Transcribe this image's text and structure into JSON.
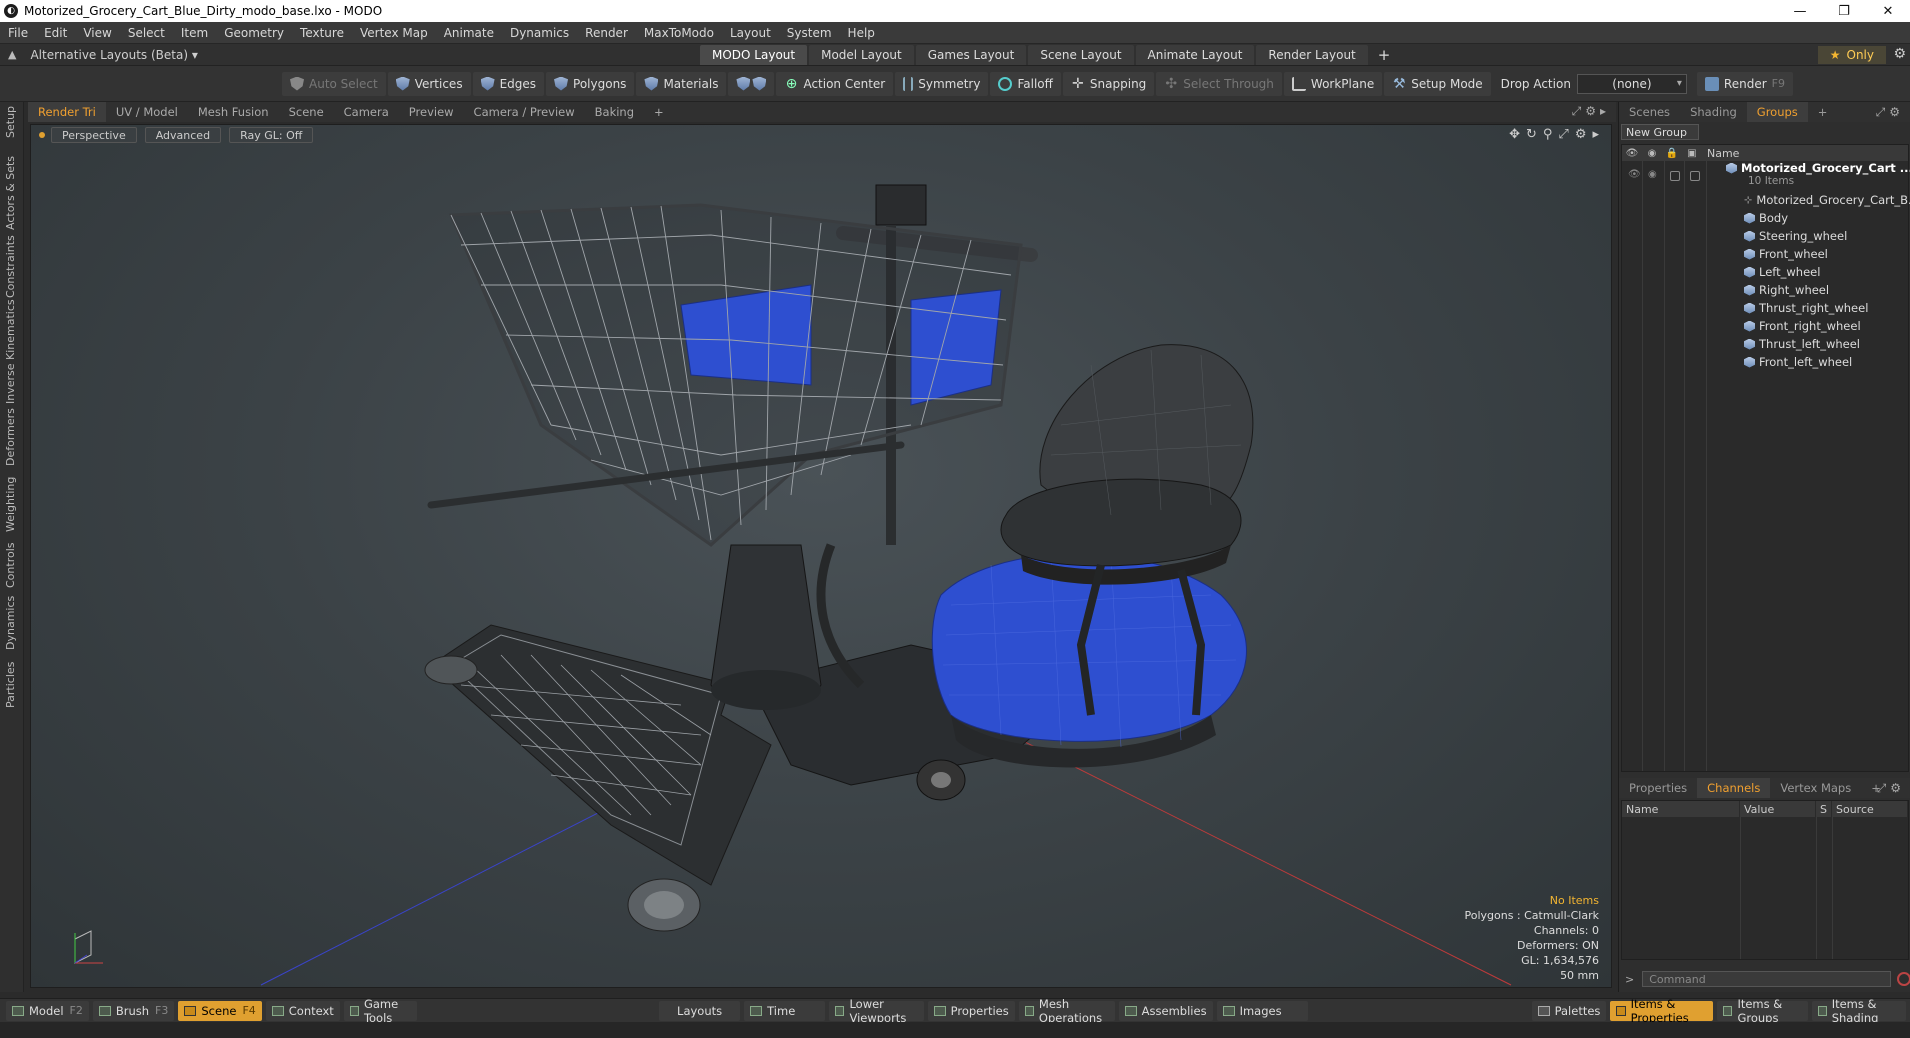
{
  "window": {
    "title": "Motorized_Grocery_Cart_Blue_Dirty_modo_base.lxo - MODO",
    "controls": [
      "—",
      "❐",
      "✕"
    ]
  },
  "menu": [
    "File",
    "Edit",
    "View",
    "Select",
    "Item",
    "Geometry",
    "Texture",
    "Vertex Map",
    "Animate",
    "Dynamics",
    "Render",
    "MaxToModo",
    "Layout",
    "System",
    "Help"
  ],
  "layouts": {
    "alt_label": "Alternative Layouts (Beta) ▾",
    "tabs": [
      "MODO Layout",
      "Model Layout",
      "Games Layout",
      "Scene Layout",
      "Animate Layout",
      "Render Layout"
    ],
    "active": 0,
    "plus": "+",
    "only": "Only"
  },
  "toolbar": {
    "auto_select": "Auto Select",
    "vertices": "Vertices",
    "edges": "Edges",
    "polygons": "Polygons",
    "materials": "Materials",
    "action_center": "Action Center",
    "symmetry": "Symmetry",
    "falloff": "Falloff",
    "snapping": "Snapping",
    "select_through": "Select Through",
    "workplane": "WorkPlane",
    "setup_mode": "Setup Mode",
    "drop_action": "Drop Action",
    "drop_value": "(none)",
    "render": "Render",
    "render_key": "F9"
  },
  "left_tabs": [
    "Setup",
    "Actors & Sets",
    "Constraints",
    "Inverse Kinematics",
    "Deformers",
    "Weighting",
    "Controls",
    "Dynamics",
    "Particles"
  ],
  "viewport_tabs": [
    "Render Tri",
    "UV / Model",
    "Mesh Fusion",
    "Scene",
    "Camera",
    "Preview",
    "Camera / Preview",
    "Baking",
    "+"
  ],
  "viewport": {
    "view": "Perspective",
    "mode": "Advanced",
    "raygl": "Ray GL: Off",
    "info": {
      "items": "No Items",
      "polygons": "Polygons : Catmull-Clark",
      "channels": "Channels: 0",
      "deformers": "Deformers: ON",
      "gl": "GL: 1,634,576",
      "lens": "50 mm"
    }
  },
  "right_tabs": [
    "Scenes",
    "Shading",
    "Groups",
    "+"
  ],
  "groups": {
    "new_group": "New Group",
    "name_col": "Name",
    "root": "Motorized_Grocery_Cart ...",
    "root_sub": "10 Items",
    "items": [
      "Motorized_Grocery_Cart_B...",
      "Body",
      "Steering_wheel",
      "Front_wheel",
      "Left_wheel",
      "Right_wheel",
      "Thrust_right_wheel",
      "Front_right_wheel",
      "Thrust_left_wheel",
      "Front_left_wheel"
    ]
  },
  "props_tabs": [
    "Properties",
    "Channels",
    "Vertex Maps",
    "+"
  ],
  "channels_cols": [
    "Name",
    "Value",
    "S",
    "Source"
  ],
  "command_placeholder": "Command",
  "bottom": {
    "model": "Model",
    "model_key": "F2",
    "brush": "Brush",
    "brush_key": "F3",
    "scene": "Scene",
    "scene_key": "F4",
    "context": "Context",
    "game_tools": "Game Tools",
    "layouts": "Layouts",
    "time": "Time",
    "lower_viewports": "Lower Viewports",
    "properties": "Properties",
    "mesh_operations": "Mesh Operations",
    "assemblies": "Assemblies",
    "images": "Images",
    "palettes": "Palettes",
    "items_properties": "Items & Properties",
    "items_groups": "Items & Groups",
    "items_shading": "Items & Shading"
  },
  "colors": {
    "accent": "#e0a030",
    "cart_blue": "#2e4fd0",
    "viewport_bg": "#3b4246"
  }
}
